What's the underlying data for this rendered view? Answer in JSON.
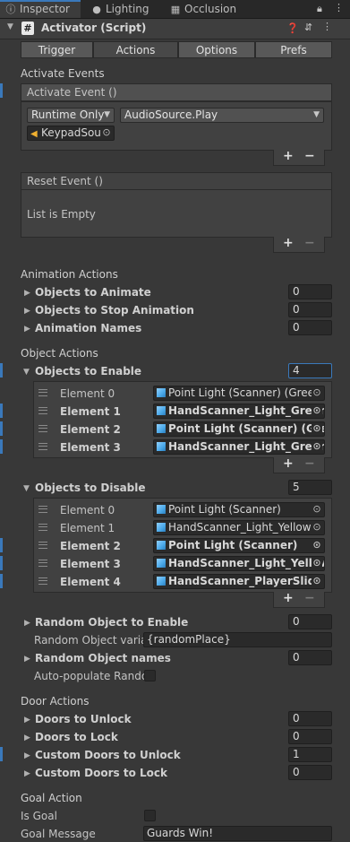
{
  "tabs": [
    {
      "label": "Inspector",
      "icon": "info-icon"
    },
    {
      "label": "Lighting",
      "icon": "bulb-icon"
    },
    {
      "label": "Occlusion",
      "icon": "occlusion-icon"
    }
  ],
  "component": {
    "title": "Activator (Script)",
    "icon": "#"
  },
  "subtabs": [
    "Trigger",
    "Actions",
    "Options",
    "Prefs"
  ],
  "activate": {
    "section": "Activate Events",
    "event_title": "Activate Event ()",
    "runtime": "Runtime Only",
    "function": "AudioSource.Play",
    "object": "KeypadSou"
  },
  "reset": {
    "title": "Reset Event ()",
    "empty": "List is Empty"
  },
  "animation": {
    "section": "Animation Actions",
    "rows": [
      {
        "label": "Objects to Animate",
        "value": "0"
      },
      {
        "label": "Objects to Stop Animation",
        "value": "0"
      },
      {
        "label": "Animation Names",
        "value": "0"
      }
    ]
  },
  "object_actions": {
    "section": "Object Actions",
    "enable": {
      "label": "Objects to Enable",
      "count": "4",
      "elements": [
        {
          "name": "Element 0",
          "value": "Point Light (Scanner) (Green"
        },
        {
          "name": "Element 1",
          "value": "HandScanner_Light_Green"
        },
        {
          "name": "Element 2",
          "value": "Point Light (Scanner) (Gree"
        },
        {
          "name": "Element 3",
          "value": "HandScanner_Light_Green"
        }
      ]
    },
    "disable": {
      "label": "Objects to Disable",
      "count": "5",
      "elements": [
        {
          "name": "Element 0",
          "value": "Point Light (Scanner)"
        },
        {
          "name": "Element 1",
          "value": "HandScanner_Light_Yellow"
        },
        {
          "name": "Element 2",
          "value": "Point Light (Scanner)"
        },
        {
          "name": "Element 3",
          "value": "HandScanner_Light_Yellow"
        },
        {
          "name": "Element 4",
          "value": "HandScanner_PlayerSlide ("
        }
      ]
    },
    "random_enable": {
      "label": "Random Object to Enable",
      "value": "0"
    },
    "random_var": {
      "label": "Random Object varial",
      "value": "{randomPlace}"
    },
    "random_names": {
      "label": "Random Object names",
      "value": "0"
    },
    "auto_populate": {
      "label": "Auto-populate Rando"
    }
  },
  "door": {
    "section": "Door Actions",
    "rows": [
      {
        "label": "Doors to Unlock",
        "value": "0"
      },
      {
        "label": "Doors to Lock",
        "value": "0"
      },
      {
        "label": "Custom Doors to Unlock",
        "value": "1"
      },
      {
        "label": "Custom Doors to Lock",
        "value": "0"
      }
    ]
  },
  "goal": {
    "section": "Goal Action",
    "is_goal": "Is Goal",
    "message_label": "Goal Message",
    "message": "Guards Win!"
  },
  "colors": {
    "accent": "#3a79bb",
    "bg": "#383838"
  }
}
